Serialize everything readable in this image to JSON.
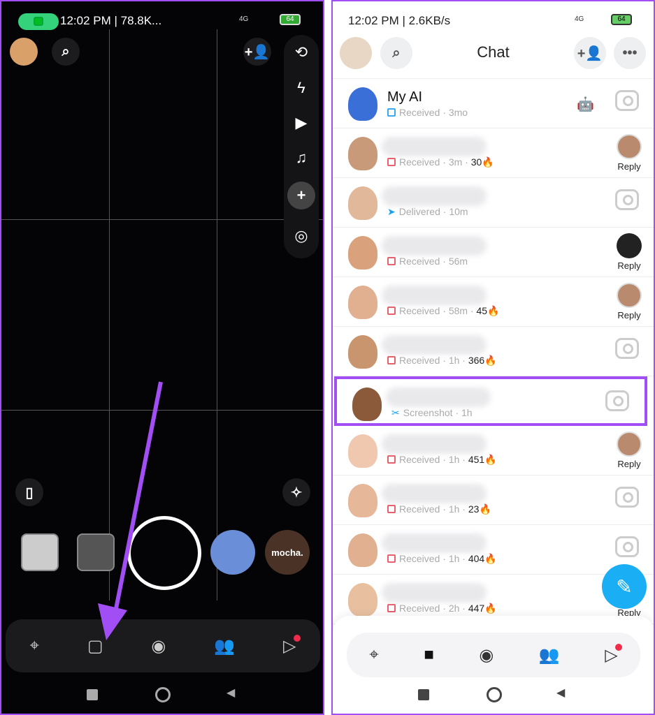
{
  "left": {
    "status_bar": {
      "time_speed": "12:02 PM | 78.8K...",
      "network": "4G",
      "battery": "64"
    },
    "lens_label": "mocha.",
    "nav": [
      "map",
      "chat",
      "camera",
      "friends",
      "spotlight"
    ]
  },
  "right": {
    "status_bar": {
      "time_speed": "12:02 PM | 2.6KB/s",
      "network": "4G",
      "battery": "64"
    },
    "title": "Chat",
    "chats": [
      {
        "name": "My AI",
        "status": "Received",
        "icon": "chat-outline-blue",
        "time": "3mo",
        "streak": "",
        "action": "camera",
        "badge": "robot"
      },
      {
        "name": "",
        "status": "Received",
        "icon": "square-red",
        "time": "3m",
        "streak": "30",
        "action": "reply",
        "reply_style": "photo"
      },
      {
        "name": "",
        "status": "Delivered",
        "icon": "arrow-blue",
        "time": "10m",
        "streak": "",
        "action": "camera"
      },
      {
        "name": "",
        "status": "Received",
        "icon": "square-red",
        "time": "56m",
        "streak": "",
        "action": "reply",
        "reply_style": "dark"
      },
      {
        "name": "",
        "status": "Received",
        "icon": "square-red",
        "time": "58m",
        "streak": "45",
        "action": "reply",
        "reply_style": "photo"
      },
      {
        "name": "",
        "status": "Received",
        "icon": "square-red",
        "time": "1h",
        "streak": "366",
        "action": "camera"
      },
      {
        "name": "",
        "status": "Screenshot",
        "icon": "screenshot-blue",
        "time": "1h",
        "streak": "",
        "action": "camera",
        "highlighted": true
      },
      {
        "name": "",
        "status": "Received",
        "icon": "square-red",
        "time": "1h",
        "streak": "451",
        "action": "reply",
        "reply_style": "photo"
      },
      {
        "name": "",
        "status": "Received",
        "icon": "square-red",
        "time": "1h",
        "streak": "23",
        "action": "camera"
      },
      {
        "name": "",
        "status": "Received",
        "icon": "square-red",
        "time": "1h",
        "streak": "404",
        "action": "camera"
      },
      {
        "name": "",
        "status": "Received",
        "icon": "square-red",
        "time": "2h",
        "streak": "447",
        "action": "reply",
        "reply_style": "photo"
      }
    ],
    "reply_label": "Reply",
    "streak_emoji": "🔥",
    "separator": "·"
  },
  "colors": {
    "highlight": "#a24ef5",
    "accent": "#1aaef5",
    "notification": "#ef2d4a"
  }
}
